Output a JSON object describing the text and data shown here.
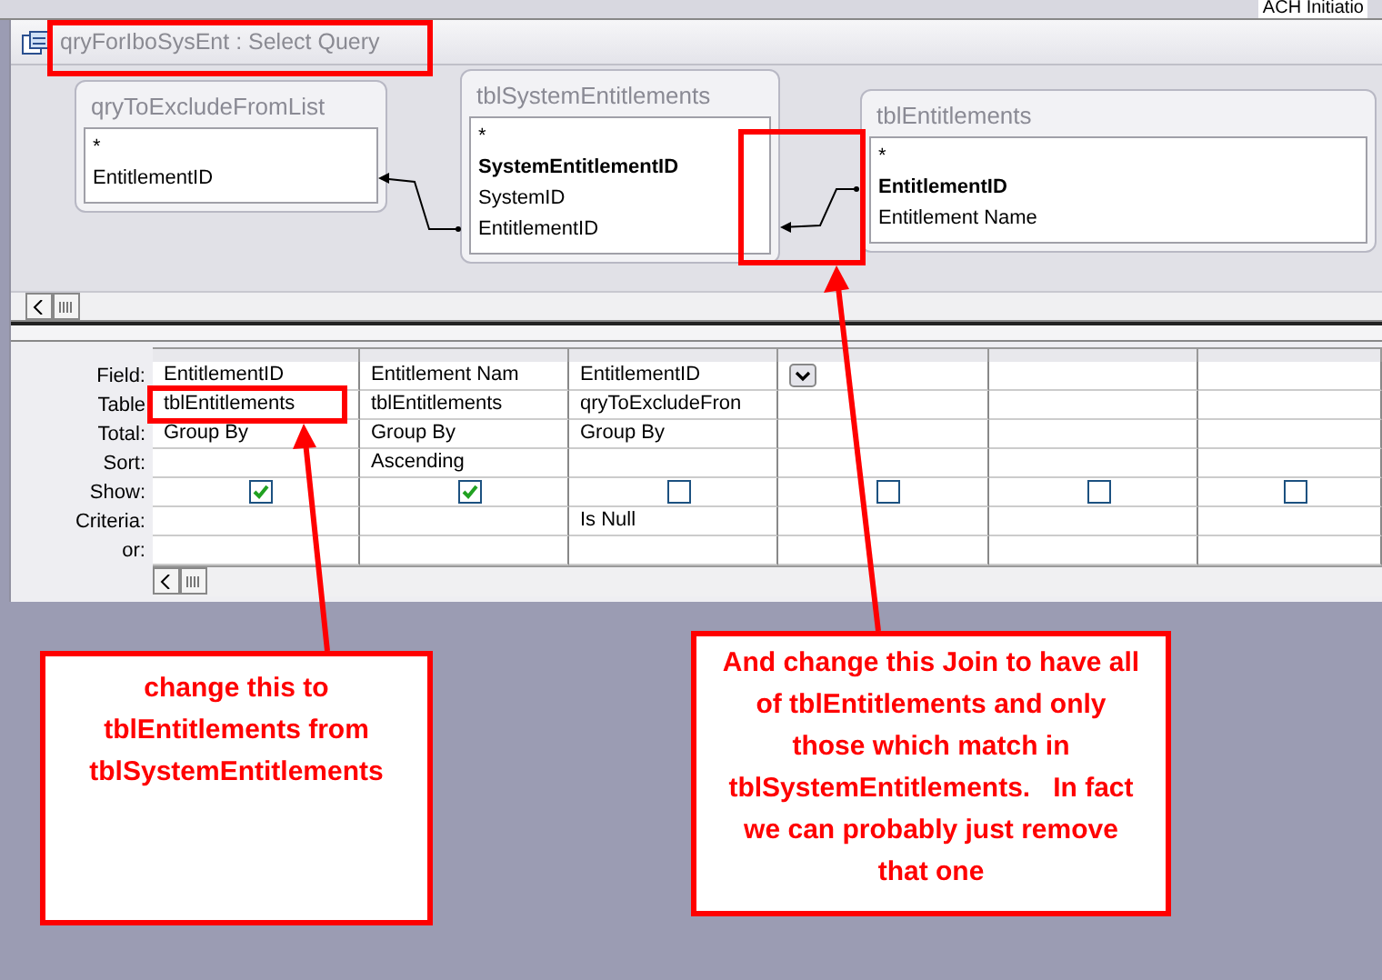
{
  "background": {
    "text": "ACH Initiatio"
  },
  "window": {
    "title": "qryForIboSysEnt : Select Query"
  },
  "tables": [
    {
      "title": "qryToExcludeFromList",
      "fields": [
        {
          "name": "*",
          "primary_key": false
        },
        {
          "name": "EntitlementID",
          "primary_key": false
        }
      ]
    },
    {
      "title": "tblSystemEntitlements",
      "fields": [
        {
          "name": "*",
          "primary_key": false
        },
        {
          "name": "SystemEntitlementID",
          "primary_key": true
        },
        {
          "name": "SystemID",
          "primary_key": false
        },
        {
          "name": "EntitlementID",
          "primary_key": false
        }
      ]
    },
    {
      "title": "tblEntitlements",
      "fields": [
        {
          "name": "*",
          "primary_key": false
        },
        {
          "name": "EntitlementID",
          "primary_key": true
        },
        {
          "name": "Entitlement Name",
          "primary_key": false
        }
      ]
    }
  ],
  "grid": {
    "row_labels": [
      "Field:",
      "Table",
      "Total:",
      "Sort:",
      "Show:",
      "Criteria:",
      "or:"
    ],
    "columns": [
      {
        "field": "EntitlementID",
        "table": "tblEntitlements",
        "total": "Group By",
        "show": true
      },
      {
        "field": "Entitlement Nam",
        "table": "tblEntitlements",
        "total": "Group By",
        "sort": "Ascending",
        "show": true
      },
      {
        "field": "EntitlementID",
        "table": "qryToExcludeFron",
        "total": "Group By",
        "show": false,
        "criteria": "Is Null"
      },
      {
        "show": false,
        "dropdown": true
      },
      {
        "show": false
      },
      {
        "show": false
      }
    ]
  },
  "callouts": [
    {
      "text": "change this to tblEntitlements from tblSystemEntitlements"
    },
    {
      "text": "And change this Join to have all of tblEntitlements and only those which match in tblSystemEntitlements.   In fact we can probably just remove that one"
    }
  ]
}
